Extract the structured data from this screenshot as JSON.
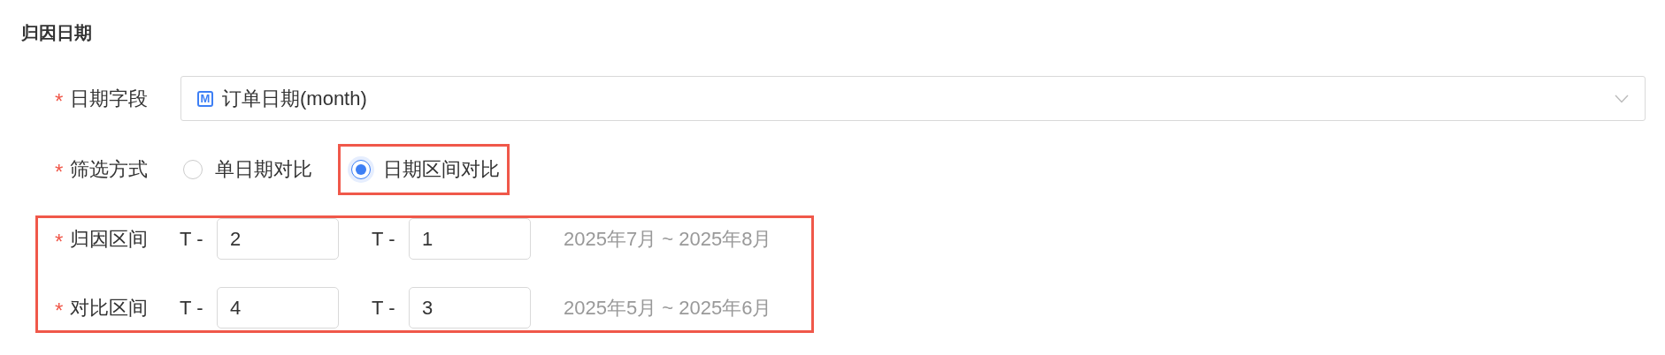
{
  "section_title": "归因日期",
  "date_field": {
    "label": "日期字段",
    "required_mark": "*",
    "value": "订单日期(month)",
    "icon_letter": "M"
  },
  "filter_mode": {
    "label": "筛选方式",
    "required_mark": "*",
    "options": [
      {
        "label": "单日期对比",
        "selected": false,
        "annotated": false
      },
      {
        "label": "日期区间对比",
        "selected": true,
        "annotated": true
      }
    ]
  },
  "ranges": {
    "annotated": true,
    "rows": [
      {
        "label": "归因区间",
        "required_mark": "*",
        "start_prefix": "T -",
        "start": "2",
        "end_prefix": "T -",
        "end": "1",
        "summary": "2025年7月 ~ 2025年8月"
      },
      {
        "label": "对比区间",
        "required_mark": "*",
        "start_prefix": "T -",
        "start": "4",
        "end_prefix": "T -",
        "end": "3",
        "summary": "2025年5月 ~ 2025年6月"
      }
    ]
  }
}
